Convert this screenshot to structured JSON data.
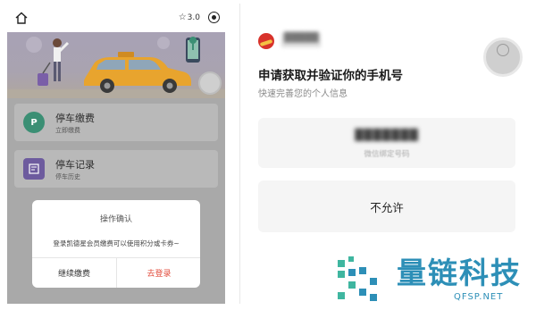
{
  "left_screen": {
    "rating": "3.0",
    "menu_items": [
      {
        "icon": "P",
        "title": "停车缴费",
        "subtitle": "立即缴费"
      },
      {
        "icon": "",
        "title": "停车记录",
        "subtitle": "停车历史"
      }
    ],
    "dialog": {
      "title": "操作确认",
      "message": "登录凯德星会员缴费可以使用积分或卡券~",
      "continue_label": "继续缴费",
      "login_label": "去登录"
    }
  },
  "right_screen": {
    "app_name": "█████",
    "request_title": "申请获取并验证你的手机号",
    "request_subtitle": "快速完善您的个人信息",
    "phone_number": "███████",
    "phone_source": "微信绑定号码",
    "deny_label": "不允许"
  },
  "watermark": {
    "name": "量链科技",
    "url": "QFSP.NET"
  },
  "colors": {
    "accent_red": "#e24a3a",
    "watermark_blue": "#2d8fb7"
  }
}
